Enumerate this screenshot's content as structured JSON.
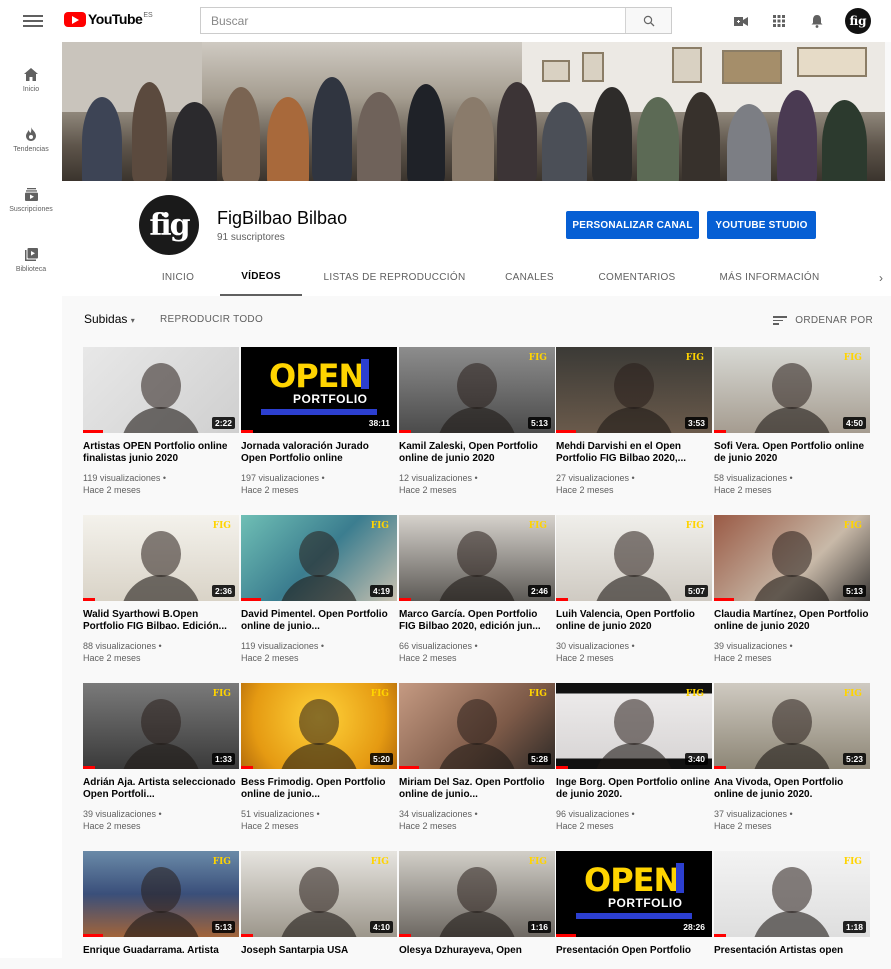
{
  "header": {
    "logo_text": "YouTube",
    "country": "ES",
    "search_placeholder": "Buscar"
  },
  "sidebar": {
    "items": [
      {
        "label": "Inicio",
        "icon": "home-icon"
      },
      {
        "label": "Tendencias",
        "icon": "trending-icon"
      },
      {
        "label": "Suscripciones",
        "icon": "subscriptions-icon"
      },
      {
        "label": "Biblioteca",
        "icon": "library-icon"
      }
    ]
  },
  "channel": {
    "avatar_text": "fig",
    "name": "FigBilbao Bilbao",
    "subscribers": "91 suscriptores",
    "customize_label": "PERSONALIZAR CANAL",
    "studio_label": "YOUTUBE STUDIO",
    "tabs": [
      "INICIO",
      "VÍDEOS",
      "LISTAS DE REPRODUCCIÓN",
      "CANALES",
      "COMENTARIOS",
      "MÁS INFORMACIÓN"
    ],
    "active_tab": "VÍDEOS"
  },
  "filters": {
    "uploads_label": "Subidas",
    "play_all_label": "REPRODUCIR TODO",
    "sort_label": "ORDENAR POR"
  },
  "videos": [
    {
      "title": "Artistas OPEN Portfolio online finalistas junio 2020",
      "views": "119 visualizaciones •",
      "age": "Hace 2 meses",
      "duration": "2:22",
      "style": "bw"
    },
    {
      "title": "Jornada valoración Jurado Open Portfolio online",
      "views": "197 visualizaciones •",
      "age": "Hace 2 meses",
      "duration": "38:11",
      "style": "open"
    },
    {
      "title": "Kamil Zaleski, Open Portfolio online de junio 2020",
      "views": "12 visualizaciones •",
      "age": "Hace 2 meses",
      "duration": "5:13",
      "style": "man-grey"
    },
    {
      "title": "Mehdi Darvishi en el Open Portfolio FIG Bilbao 2020,...",
      "views": "27 visualizaciones •",
      "age": "Hace 2 meses",
      "duration": "3:53",
      "style": "man-dark"
    },
    {
      "title": "Sofi Vera. Open Portfolio online de junio 2020",
      "views": "58 visualizaciones •",
      "age": "Hace 2 meses",
      "duration": "4:50",
      "style": "woman-light"
    },
    {
      "title": "Walid Syarthowi B.Open Portfolio FIG Bilbao. Edición...",
      "views": "88 visualizaciones •",
      "age": "Hace 2 meses",
      "duration": "2:36",
      "style": "room-white"
    },
    {
      "title": "David Pimentel. Open Portfolio online de junio...",
      "views": "119 visualizaciones •",
      "age": "Hace 2 meses",
      "duration": "4:19",
      "style": "graffiti"
    },
    {
      "title": "Marco García. Open Portfolio FIG Bilbao 2020, edición jun...",
      "views": "66 visualizaciones •",
      "age": "Hace 2 meses",
      "duration": "2:46",
      "style": "man-black"
    },
    {
      "title": "Luih Valencia, Open Portfolio online de junio 2020",
      "views": "30 visualizaciones •",
      "age": "Hace 2 meses",
      "duration": "5:07",
      "style": "man-white"
    },
    {
      "title": "Claudia Martínez, Open Portfolio online de junio 2020",
      "views": "39 visualizaciones •",
      "age": "Hace 2 meses",
      "duration": "5:13",
      "style": "art-brown"
    },
    {
      "title": "Adrián Aja. Artista seleccionado Open Portfoli...",
      "views": "39 visualizaciones •",
      "age": "Hace 2 meses",
      "duration": "1:33",
      "style": "man-bw"
    },
    {
      "title": "Bess Frimodig. Open Portfolio online de junio...",
      "views": "51 visualizaciones •",
      "age": "Hace 2 meses",
      "duration": "5:20",
      "style": "yellow"
    },
    {
      "title": "Miriam Del Saz. Open Portfolio online de junio...",
      "views": "34 visualizaciones •",
      "age": "Hace 2 meses",
      "duration": "5:28",
      "style": "woman-room"
    },
    {
      "title": "Inge Borg. Open Portfolio online de junio 2020.",
      "views": "96 visualizaciones •",
      "age": "Hace 2 meses",
      "duration": "3:40",
      "style": "woman-white"
    },
    {
      "title": "Ana Vivoda, Open Portfolio online de junio 2020.",
      "views": "37 visualizaciones •",
      "age": "Hace 2 meses",
      "duration": "5:23",
      "style": "woman-wall"
    },
    {
      "title": "Enrique Guadarrama. Artista",
      "views": "",
      "age": "",
      "duration": "5:13",
      "style": "blocks"
    },
    {
      "title": "Joseph Santarpia USA",
      "views": "",
      "age": "",
      "duration": "4:10",
      "style": "man-home"
    },
    {
      "title": "Olesya Dzhurayeva, Open",
      "views": "",
      "age": "",
      "duration": "1:16",
      "style": "woman-frames"
    },
    {
      "title": "Presentación Open Portfolio",
      "views": "",
      "age": "",
      "duration": "28:26",
      "style": "open"
    },
    {
      "title": "Presentación Artistas open",
      "views": "",
      "age": "",
      "duration": "1:18",
      "style": "gallery"
    }
  ],
  "thumb_texts": {
    "fig_badge": "FIG",
    "open_word": "OPEN",
    "portfolio_word": "PORTFOLIO"
  },
  "colors": {
    "accent_blue": "#065fd4",
    "youtube_red": "#ff0000",
    "fig_yellow": "#ffd400"
  }
}
